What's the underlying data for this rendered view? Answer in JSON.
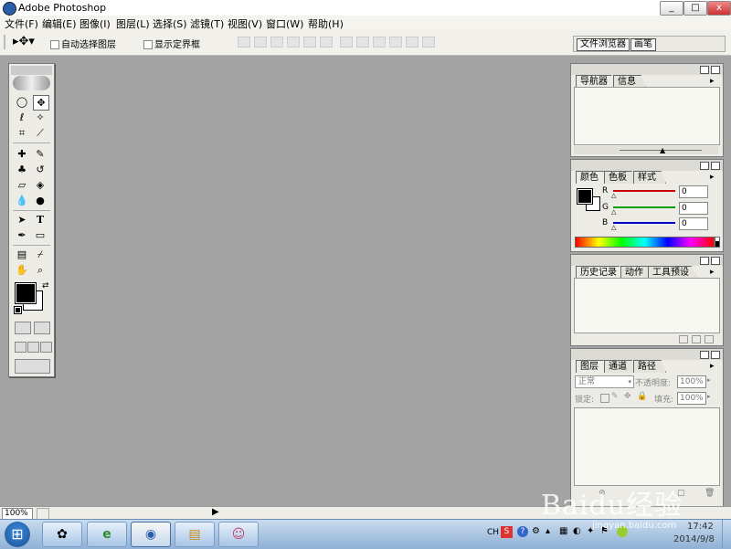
{
  "window": {
    "title": "Adobe Photoshop",
    "controls": {
      "minimize": "_",
      "maximize": "□",
      "close": "x"
    }
  },
  "menu": [
    "文件(F)",
    "编辑(E)",
    "图像(I)",
    "图层(L)",
    "选择(S)",
    "滤镜(T)",
    "视图(V)",
    "窗口(W)",
    "帮助(H)"
  ],
  "options": {
    "auto_select_layer": "自动选择图层",
    "show_bounding_box": "显示定界框"
  },
  "palette_well": {
    "tabs": [
      "文件浏览器",
      "画笔"
    ]
  },
  "toolbox": {
    "icons": {
      "marquee": "◯",
      "move": "✥",
      "lasso": "ℓ",
      "magic_wand": "✧",
      "crop": "⌗",
      "slice": "⟋",
      "healing": "✚",
      "brush": "✎",
      "stamp": "♣",
      "history_brush": "↺",
      "eraser": "▱",
      "fill": "◈",
      "blur": "💧",
      "dodge": "●",
      "path_select": "➤",
      "type": "T",
      "pen": "✒",
      "shape": "▭",
      "notes": "▤",
      "eyedropper": "⌿",
      "hand": "✋",
      "zoom": "⌕",
      "swap": "⇄"
    }
  },
  "navigator": {
    "tabs": [
      "导航器",
      "信息"
    ]
  },
  "color": {
    "tabs": [
      "颜色",
      "色板",
      "样式"
    ],
    "channels": [
      {
        "label": "R",
        "value": "0",
        "color": "#cc0000"
      },
      {
        "label": "G",
        "value": "0",
        "color": "#00a000"
      },
      {
        "label": "B",
        "value": "0",
        "color": "#0000cc"
      }
    ]
  },
  "history": {
    "tabs": [
      "历史记录",
      "动作",
      "工具预设"
    ]
  },
  "layers": {
    "tabs": [
      "图层",
      "通道",
      "路径"
    ],
    "blend_mode": "正常",
    "opacity_label": "不透明度:",
    "opacity_value": "100%",
    "lock_label": "锁定:",
    "fill_label": "填充:",
    "fill_value": "100%"
  },
  "status": {
    "zoom": "100%",
    "arrow": "▶"
  },
  "taskbar": {
    "start_icon": "⊞",
    "apps": [
      "✿",
      "e",
      "◉",
      "▤",
      "☺"
    ],
    "tray_lang": "CH",
    "time": "17:42",
    "date": "2014/9/8"
  },
  "watermark": {
    "logo": "Baidu经验",
    "url": "jingyan.baidu.com"
  }
}
